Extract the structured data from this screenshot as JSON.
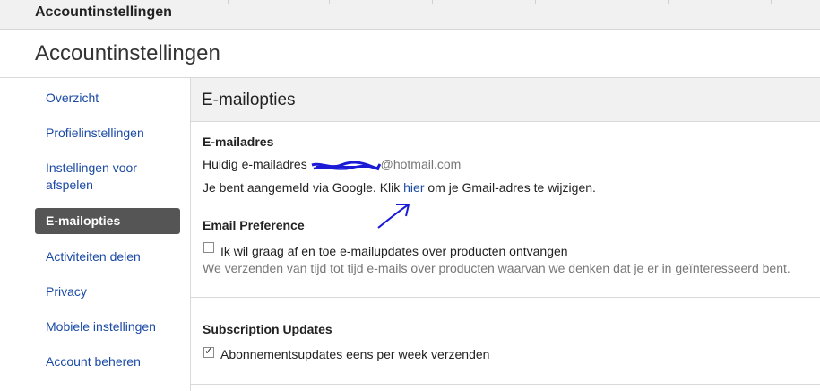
{
  "topbar": {
    "title": "Accountinstellingen"
  },
  "page": {
    "title": "Accountinstellingen"
  },
  "sidebar": {
    "items": [
      {
        "label": "Overzicht"
      },
      {
        "label": "Profielinstellingen"
      },
      {
        "label": "Instellingen voor afspelen"
      },
      {
        "label": "E-mailopties"
      },
      {
        "label": "Activiteiten delen"
      },
      {
        "label": "Privacy"
      },
      {
        "label": "Mobiele instellingen"
      },
      {
        "label": "Account beheren"
      }
    ],
    "active_index": 3
  },
  "panel": {
    "title": "E-mailopties",
    "email_section": {
      "title": "E-mailadres",
      "current_label": "Huidig e-mailadres",
      "email_domain": "@hotmail.com",
      "google_text_before": "Je bent aangemeld via Google. Klik",
      "google_link": "hier",
      "google_text_after": "om je Gmail-adres te wijzigen."
    },
    "preference_section": {
      "title": "Email Preference",
      "checkbox_label": "Ik wil graag af en toe e-mailupdates over producten ontvangen",
      "checkbox_checked": false,
      "note": "We verzenden van tijd tot tijd e-mails over producten waarvan we denken dat je er in geïnteresseerd bent."
    },
    "subscription_section": {
      "title": "Subscription Updates",
      "checkbox_label": "Abonnementsupdates eens per week verzenden",
      "checkbox_checked": true
    }
  },
  "colors": {
    "link": "#1a4aa6",
    "active_bg": "#555555",
    "annotation": "#1b1bd6"
  }
}
